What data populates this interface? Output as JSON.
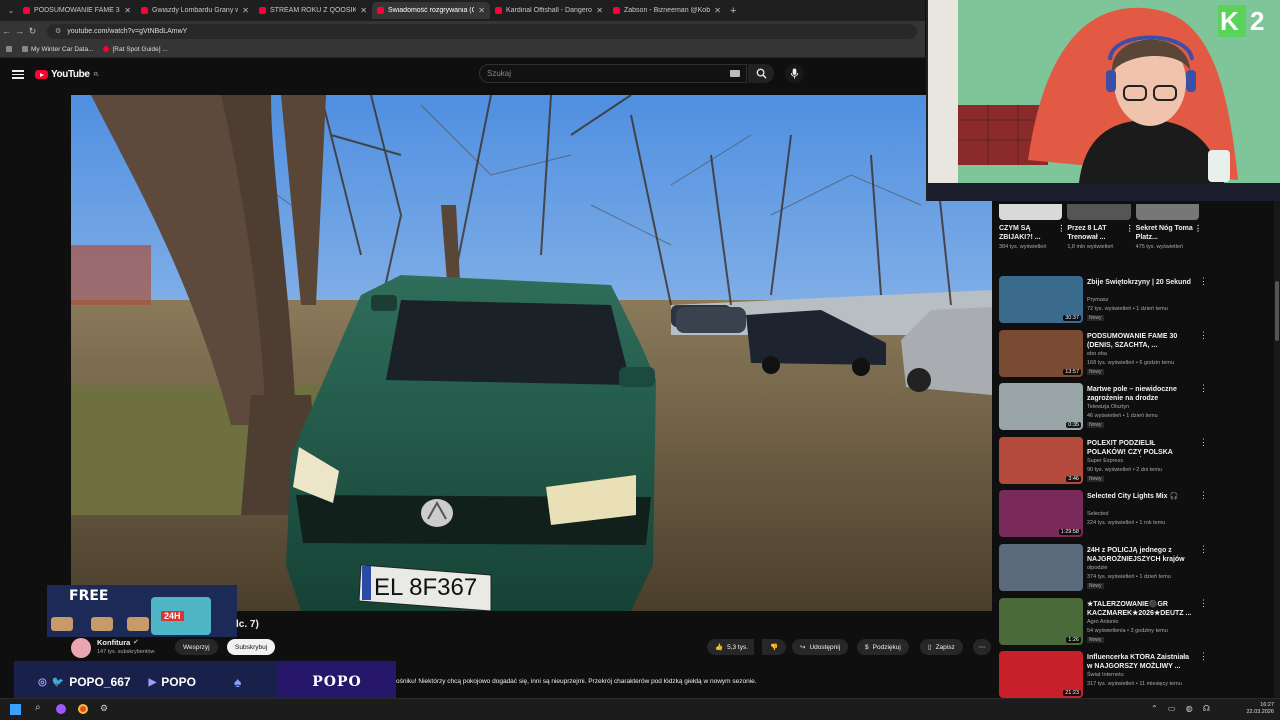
{
  "browser": {
    "tabs": [
      {
        "label": "PODSUMOWANIE FAME 30 (D..."
      },
      {
        "label": "Gwiazdy Lombardu Grany w R"
      },
      {
        "label": "STREAM ROKU Z QOOSIK | W..."
      },
      {
        "label": "Świadomość rozgrywania (C..."
      },
      {
        "label": "Kardinal Offishall - Dangerous"
      },
      {
        "label": "Żabson - Bizneeman @Kobi Pr"
      }
    ],
    "url": "youtube.com/watch?v=gVtNBdLAmwY",
    "bookmarks": [
      "My Winter Car Data...",
      "[Rat Spot Guide] ..."
    ]
  },
  "youtube": {
    "logo": "YouTube",
    "country": "PL",
    "search_placeholder": "Szukaj"
  },
  "video": {
    "title_visible": "lc. 7)",
    "plate": "EL 8F367"
  },
  "channel": {
    "name": "Konfitura",
    "subscribers": "147 tys. subskrybentów",
    "support_label": "Wesprzyj",
    "subscribe_label": "Subskrybuj"
  },
  "actions": {
    "likes": "5,3 tys.",
    "share": "Udostępnij",
    "thanks": "Podziękuj",
    "save": "Zapisz"
  },
  "description": "ośniku! Niektórzy chcą pokojowo dogadać się, inni są nieuprzejmi. Przekrój charakterów pod łódzką giełdą w nowym sezonie.",
  "overlay": {
    "free_label": "FREE",
    "badge": "24H",
    "handle_instagram_twitter": "POPO_667",
    "handle_youtube": "POPO",
    "logo": "POPO"
  },
  "webcam": {
    "corner": "K 2"
  },
  "shorts": [
    {
      "title": "CZYM SĄ ZBIJAKI?! ...",
      "views": "384 tys. wyświetleń"
    },
    {
      "title": "Przez 8 LAT Trenował ...",
      "views": "1,8 mln wyświetleń"
    },
    {
      "title": "Sekret Nóg Toma Platz...",
      "views": "475 tys. wyświetleń"
    }
  ],
  "recommendations": [
    {
      "title": "Zbije Świętokrzyny | 20 Sekund",
      "channel": "Prymasz",
      "meta": "72 tys. wyświetleń • 1 dzień temu",
      "badge": "Nowy",
      "duration": "30:37",
      "color": "#3b6b8c"
    },
    {
      "title": "PODSUMOWANIE FAME 30 (DENIS, SZACHTA, ...",
      "channel": "ebo eba",
      "meta": "168 tys. wyświetleń • 6 godzin temu",
      "badge": "Nowy",
      "duration": "13:57",
      "color": "#7a4a32"
    },
    {
      "title": "Martwe pole – niewidoczne zagrożenie na drodze",
      "channel": "Telewizja Olsztyn",
      "meta": "46 wyświetleń • 1 dzień temu",
      "badge": "Nowy",
      "duration": "0:35",
      "color": "#9aa5a8"
    },
    {
      "title": "POLEXIT PODZIELIŁ POLAKÓW! CZY POLSKA POWINNA WYJŚ...",
      "channel": "Super Express",
      "meta": "90 tys. wyświetleń • 2 dni temu",
      "badge": "Nowy",
      "duration": "3:46",
      "color": "#b44a3c"
    },
    {
      "title": "Selected City Lights Mix 🎧",
      "channel": "Selected",
      "meta": "224 tys. wyświetleń • 1 rok temu",
      "badge": "",
      "duration": "1:29:58",
      "color": "#7a2a5a"
    },
    {
      "title": "24H z POLICJĄ jednego z NAJGROŹNIEJSZYCH krajów ...",
      "channel": "olpodzie",
      "meta": "374 tys. wyświetleń • 1 dzień temu",
      "badge": "Nowy",
      "duration": "",
      "color": "#5a6a7a"
    },
    {
      "title": "★TALERZOWANIE⚫GR KACZMAREK★2026★DEUTZ ...",
      "channel": "Agro Antonio",
      "meta": "54 wyświetlenia • 3 godziny temu",
      "badge": "Nowy",
      "duration": "1:26",
      "color": "#4a6a3a"
    },
    {
      "title": "Influencerka KTÓRA Zaistniała w NAJGORSZY MOŻLIWY ...",
      "channel": "Świat Internetu",
      "meta": "317 tys. wyświetleń • 11 miesięcy temu",
      "badge": "",
      "duration": "21:23",
      "color": "#c8202a"
    }
  ],
  "taskbar": {
    "time": "16:27",
    "date": "22.03.2026"
  }
}
